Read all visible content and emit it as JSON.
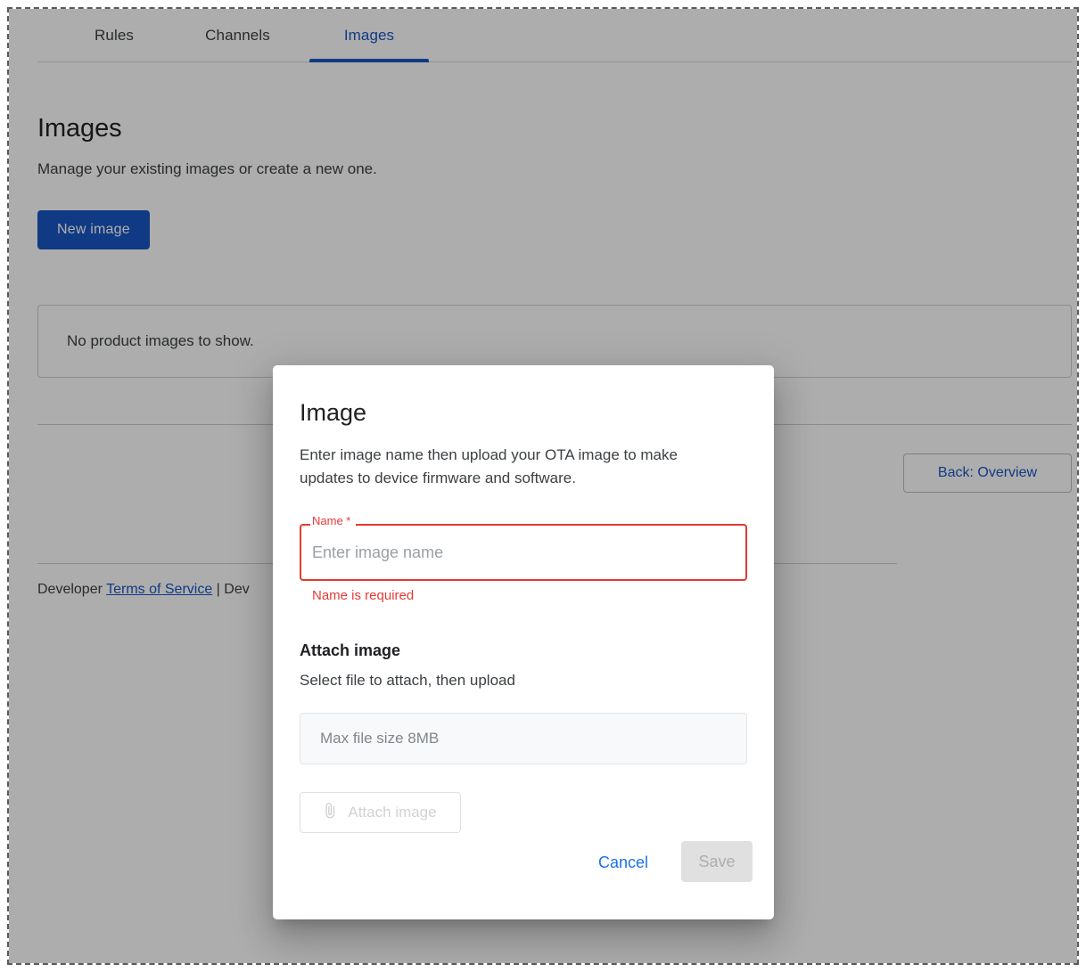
{
  "tabs": [
    {
      "label": "Rules",
      "active": false
    },
    {
      "label": "Channels",
      "active": false
    },
    {
      "label": "Images",
      "active": true
    }
  ],
  "page": {
    "title": "Images",
    "subtitle": "Manage your existing images or create a new one.",
    "new_image_button": "New image",
    "empty_state": "No product images to show.",
    "back_button": "Back: Overview"
  },
  "footer": {
    "prefix": "Developer ",
    "link": "Terms of Service",
    "separator": " | ",
    "suffix": "Dev"
  },
  "modal": {
    "title": "Image",
    "description": "Enter image name then upload your OTA image to make updates to device firmware and software.",
    "name_field": {
      "label": "Name *",
      "value": "",
      "placeholder": "Enter image name",
      "error": "Name is required"
    },
    "attach": {
      "heading": "Attach image",
      "subheading": "Select file to attach, then upload",
      "dropzone_text": "Max file size 8MB",
      "attach_button": "Attach image",
      "attach_icon": "paperclip-icon"
    },
    "cancel_button": "Cancel",
    "save_button": "Save"
  },
  "colors": {
    "accent_blue": "#1a56c4",
    "link_blue": "#1a73e8",
    "error_red": "#e53935",
    "disabled_gray": "#e0e0e0"
  }
}
